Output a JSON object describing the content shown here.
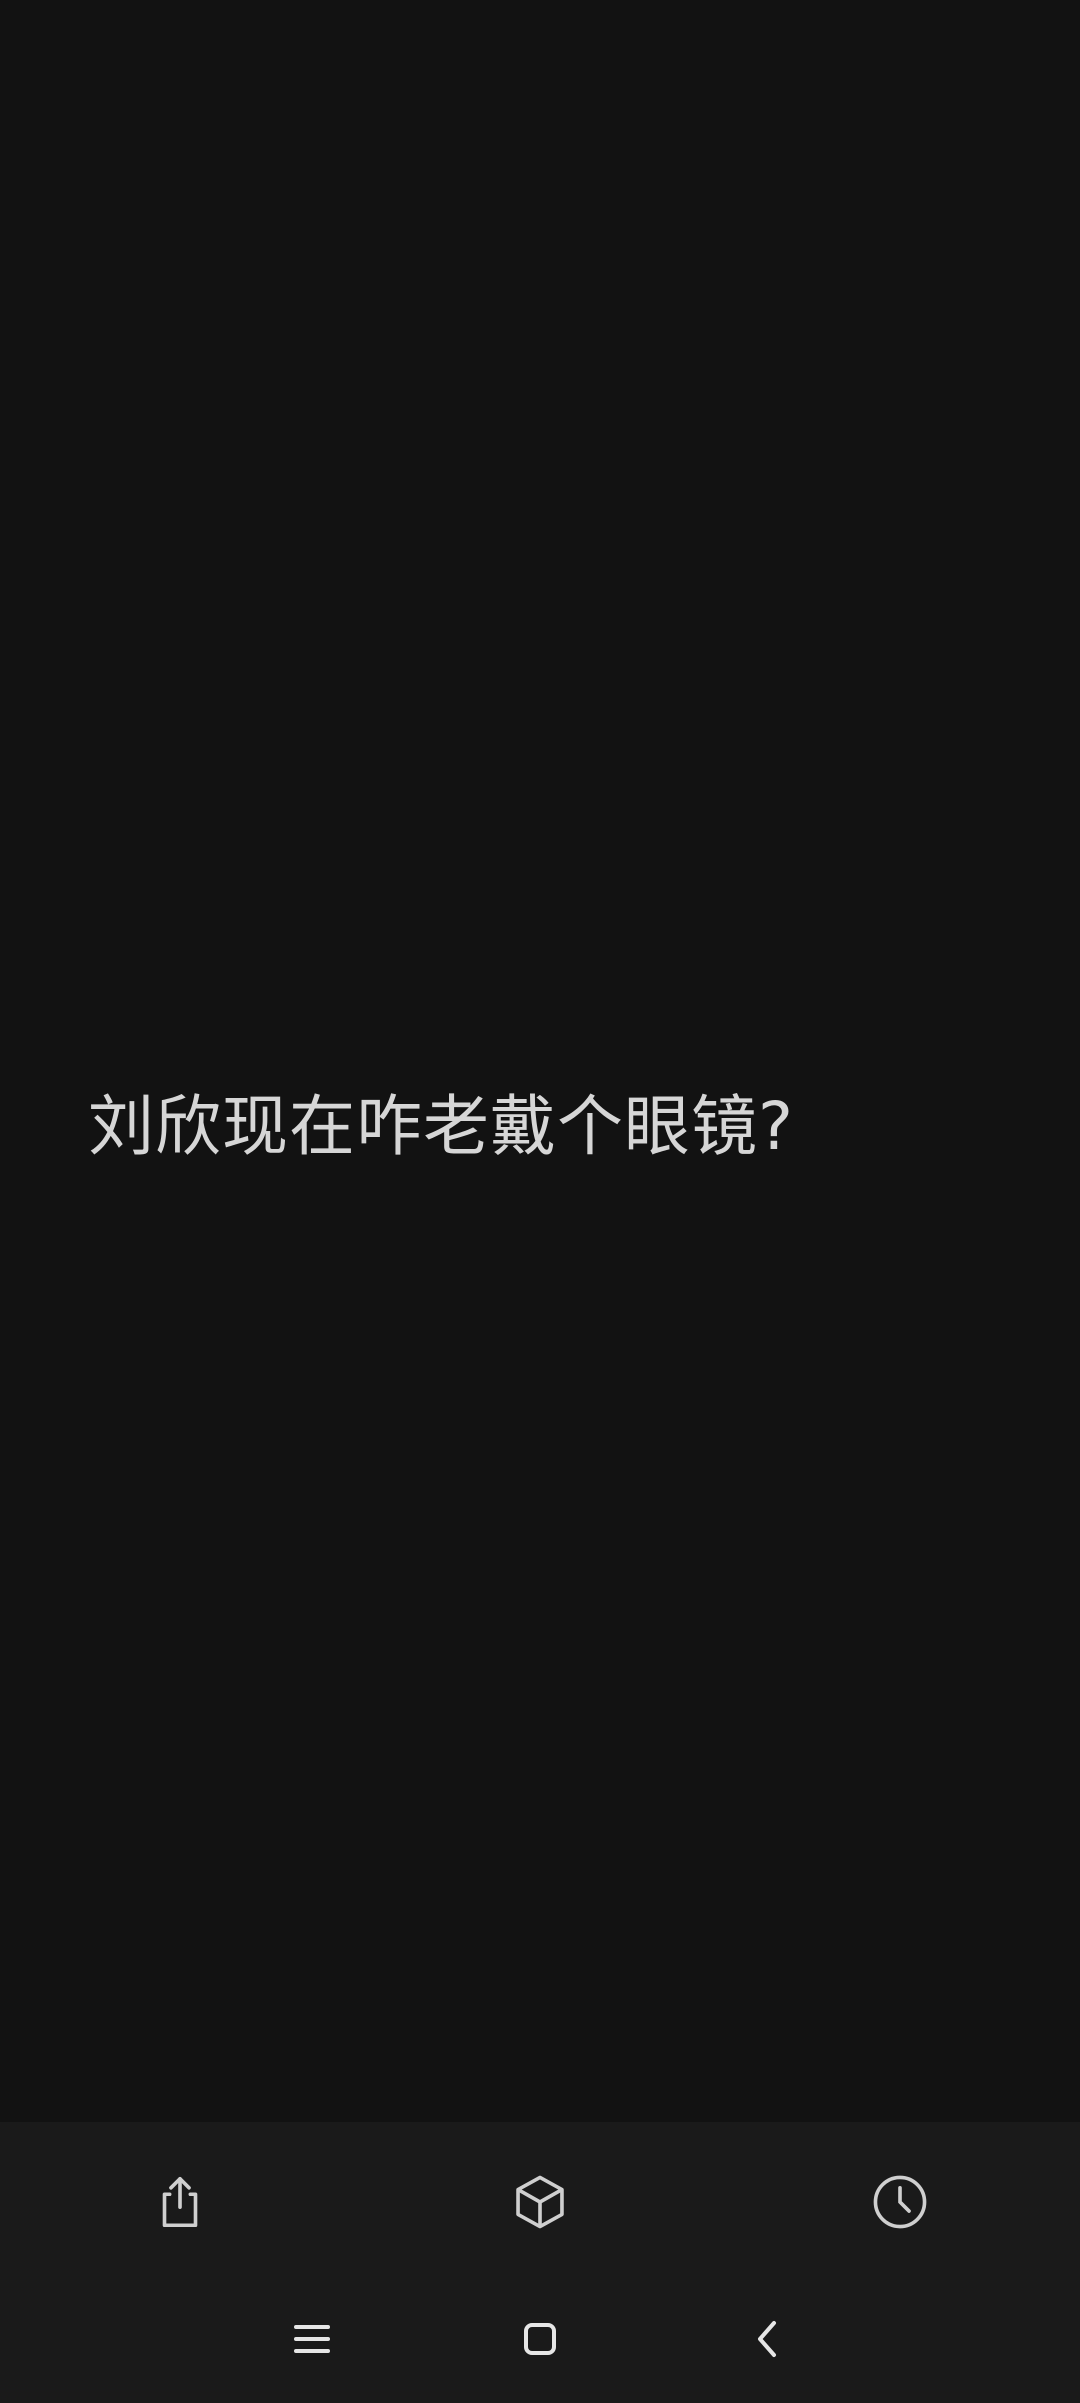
{
  "post": {
    "text": "刘欣现在咋老戴个眼镜?"
  },
  "toolbar": {
    "items": [
      {
        "icon": "share-icon"
      },
      {
        "icon": "cube-icon"
      },
      {
        "icon": "clock-icon"
      }
    ]
  },
  "navigation": {
    "items": [
      {
        "icon": "recent-apps-icon"
      },
      {
        "icon": "home-icon"
      },
      {
        "icon": "back-icon"
      }
    ]
  },
  "colors": {
    "background": "#121212",
    "bar_background": "#1a1a1a",
    "text": "#d6d6d6",
    "icon": "#cfcfcf"
  }
}
